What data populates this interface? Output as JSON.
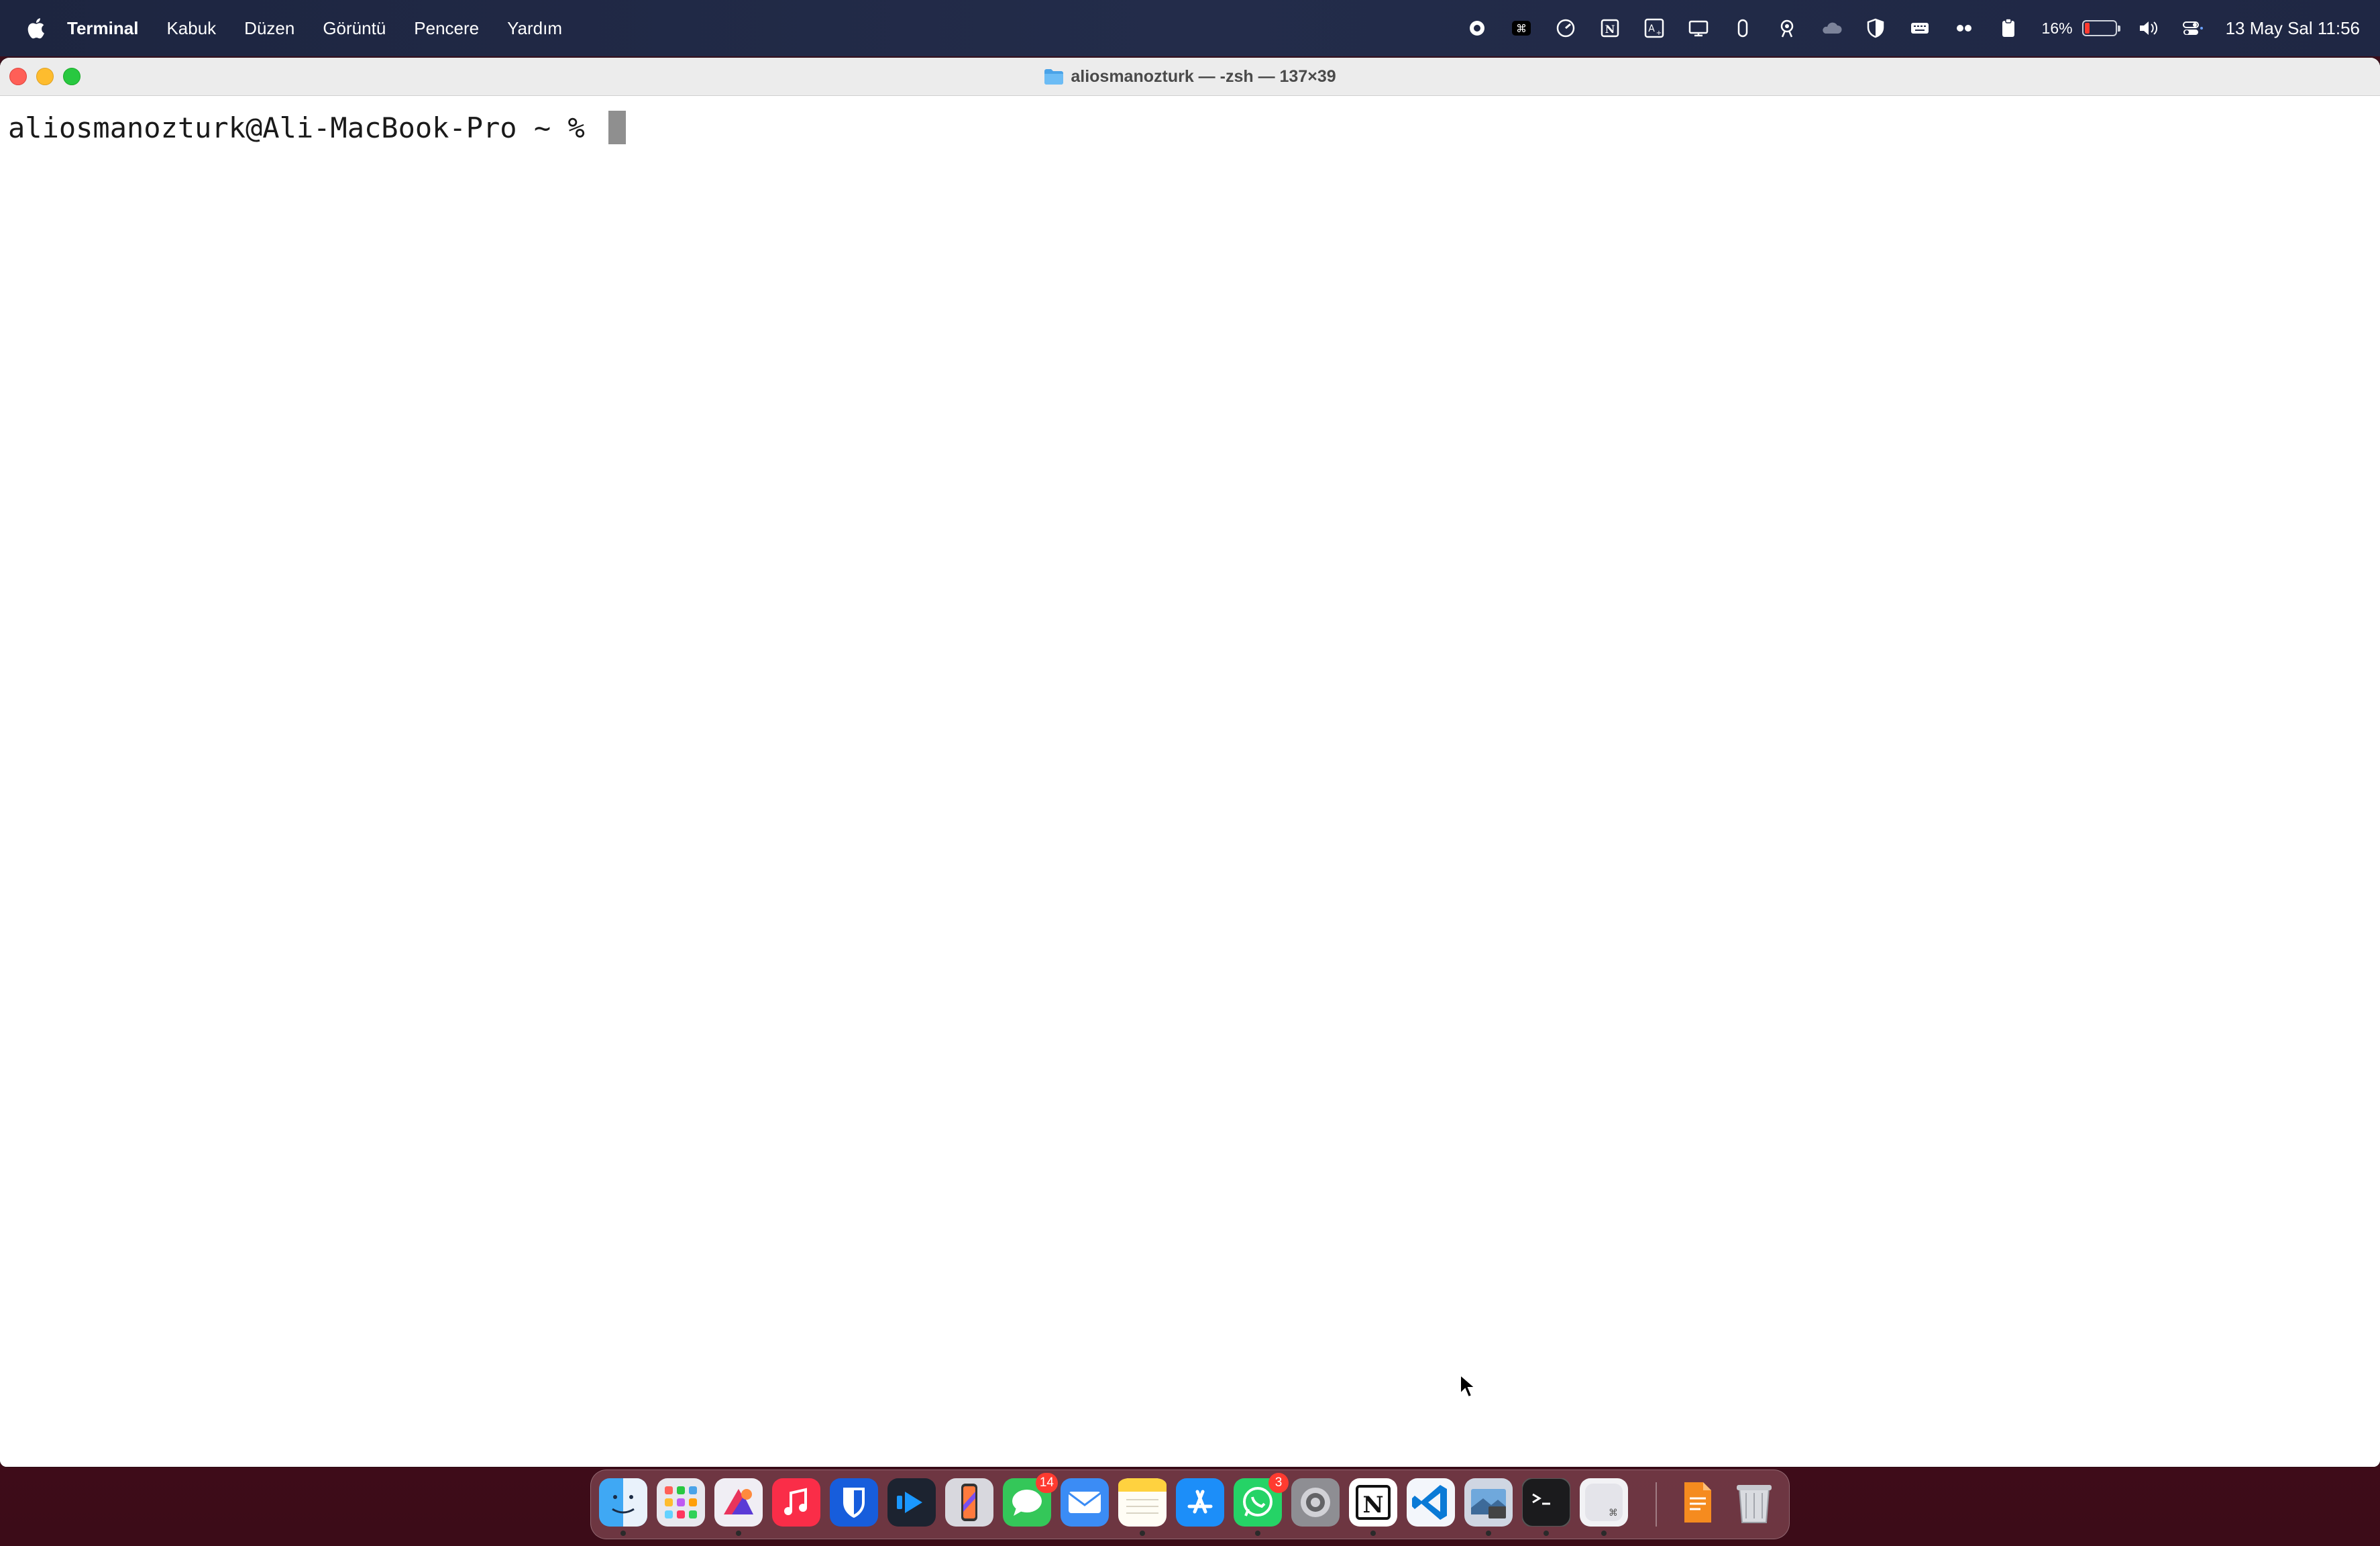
{
  "menubar": {
    "app_name": "Terminal",
    "menus": [
      "Kabuk",
      "Düzen",
      "Görüntü",
      "Pencere",
      "Yardım"
    ],
    "battery_percent": "16%",
    "battery_level": 0.16,
    "clock": "13 May Sal  11:56",
    "status_icons": [
      "screen-record-icon",
      "command-key-icon",
      "speedometer-icon",
      "notion-icon",
      "translate-icon",
      "display-icon",
      "mouse-icon",
      "robot-icon",
      "cloud-icon",
      "shield-icon",
      "keyboard-icon",
      "dots-icon",
      "clipboard-icon",
      "battery-icon",
      "volume-icon",
      "control-center-icon"
    ]
  },
  "window": {
    "title": "aliosmanozturk — -zsh — 137×39",
    "prompt": "aliosmanozturk@Ali-MacBook-Pro ~ % "
  },
  "dock": {
    "apps": [
      {
        "name": "finder"
      },
      {
        "name": "launchpad"
      },
      {
        "name": "affinity"
      },
      {
        "name": "music"
      },
      {
        "name": "bitwarden"
      },
      {
        "name": "prime-video"
      },
      {
        "name": "iphone-mirroring"
      },
      {
        "name": "messages",
        "badge": "14"
      },
      {
        "name": "mail"
      },
      {
        "name": "notes"
      },
      {
        "name": "app-store"
      },
      {
        "name": "whatsapp",
        "badge": "3"
      },
      {
        "name": "system-settings"
      },
      {
        "name": "notion"
      },
      {
        "name": "vscode"
      },
      {
        "name": "preview"
      },
      {
        "name": "terminal"
      },
      {
        "name": "keyboard-utility"
      },
      {
        "name": "pages"
      },
      {
        "name": "trash"
      }
    ]
  },
  "colors": {
    "menubar_bg": "#1f2744",
    "window_bg": "#ffffff",
    "close": "#ff5f57",
    "minimize": "#febc2e",
    "maximize": "#28c840",
    "battery_low": "#ff3b30"
  }
}
